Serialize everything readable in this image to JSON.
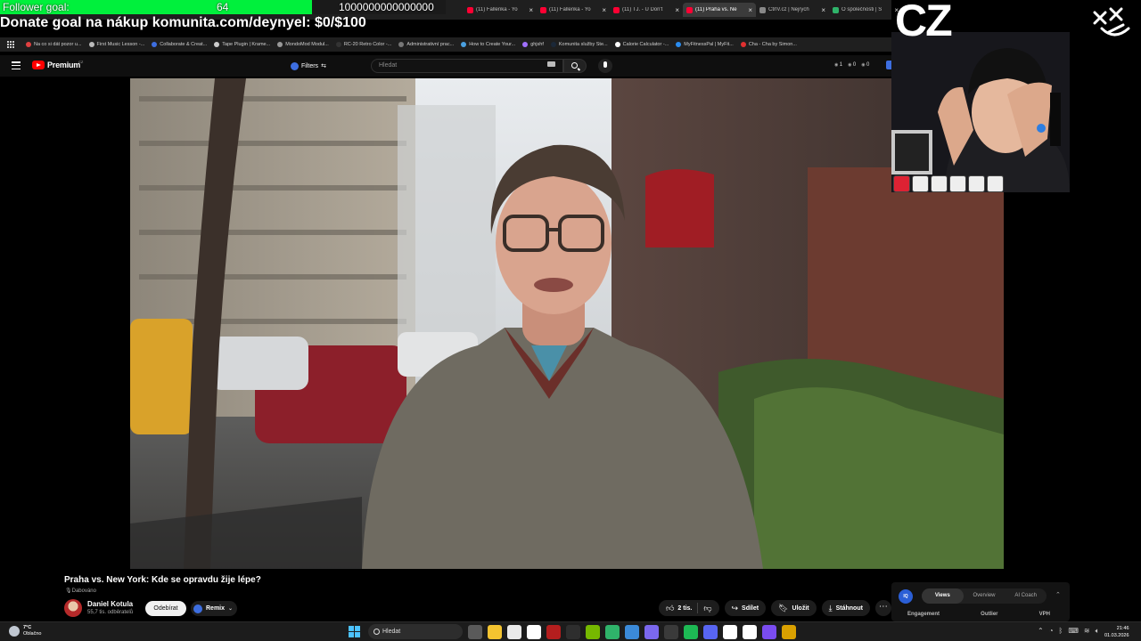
{
  "browser": {
    "tabs": [
      {
        "title": "(11) Fallenka - Yo",
        "color": "#ff0033",
        "active": false
      },
      {
        "title": "(11) Fallenka - Yo",
        "color": "#ff0033",
        "active": false
      },
      {
        "title": "(11) TJ. - U Don't",
        "color": "#ff0033",
        "active": false
      },
      {
        "title": "(11) Praha vs. Ne",
        "color": "#ff0033",
        "active": true
      },
      {
        "title": "CtrlV.cz | Nejrych",
        "color": "#888888",
        "active": false
      },
      {
        "title": "O společnosti | S",
        "color": "#2fb36a",
        "active": false
      }
    ],
    "tab_close": "×",
    "bookmarks": [
      {
        "label": "Na co si dát pozor u...",
        "color": "#e04040"
      },
      {
        "label": "First Music Lesson -...",
        "color": "#bbbbbb"
      },
      {
        "label": "Collaborate & Creat...",
        "color": "#3d6ee0"
      },
      {
        "label": "Tape Plugin | Krame...",
        "color": "#cccccc"
      },
      {
        "label": "MondoMod Modul...",
        "color": "#999999"
      },
      {
        "label": "RC-20 Retro Color -...",
        "color": "#333333"
      },
      {
        "label": "Administrativní prac...",
        "color": "#777777"
      },
      {
        "label": "How to Create Your...",
        "color": "#4aa0e0"
      },
      {
        "label": "ghjshf",
        "color": "#a070ff"
      },
      {
        "label": "Komunita služby Ste...",
        "color": "#1b2838"
      },
      {
        "label": "Calorie Calculator -...",
        "color": "#ffffff"
      },
      {
        "label": "MyFitnessPal | MyFit...",
        "color": "#2a8cf0"
      },
      {
        "label": "Cha - Cha by Simon...",
        "color": "#e03030"
      }
    ]
  },
  "overlay": {
    "follower_label": "Follower goal:",
    "follower_current": "64",
    "follower_target": "1000000000000000",
    "follower_progress": 0.7,
    "donate_text": "Donate goal na nákup komunita.com/deynyel: $0/$100",
    "cz_text": "CZ"
  },
  "youtube": {
    "logo_text": "Premium",
    "logo_region": "CZ",
    "filters_label": "Filters",
    "search_placeholder": "Hledat",
    "ext_stats": [
      "1",
      "0",
      "0"
    ]
  },
  "video": {
    "title": "Praha vs. New York: Kde se opravdu žije lépe?",
    "dubbed": "Dabováno",
    "channel_name": "Daniel Kotula",
    "channel_subs": "55,7 tis. odběratelů",
    "subscribe_label": "Odebírat",
    "remix_label": "Remix",
    "like_count": "2 tis.",
    "share_label": "Sdílet",
    "save_label": "Uložit",
    "download_label": "Stáhnout",
    "more_label": "⋯"
  },
  "vidiq": {
    "logo": "IQ",
    "tabs": [
      "Views",
      "Overview",
      "AI Coach"
    ],
    "active_tab": "Views",
    "columns": [
      "Engagement",
      "Outlier",
      "VPH"
    ]
  },
  "taskbar": {
    "weather_temp": "7°C",
    "weather_desc": "Oblačno",
    "search_label": "Hledat",
    "time": "21:46",
    "date": "01.03.2026",
    "apps": [
      "#5a5a5a",
      "#f4c430",
      "#e9e9e9",
      "#ffffff",
      "#b41e1e",
      "#2e2e2e",
      "#76b900",
      "#2fb36a",
      "#3b8ad9",
      "#7b68ee",
      "#3a3a3a",
      "#1db954",
      "#5865f2",
      "#ffffff",
      "#ffffff",
      "#7a4cf0",
      "#d9a000"
    ]
  }
}
